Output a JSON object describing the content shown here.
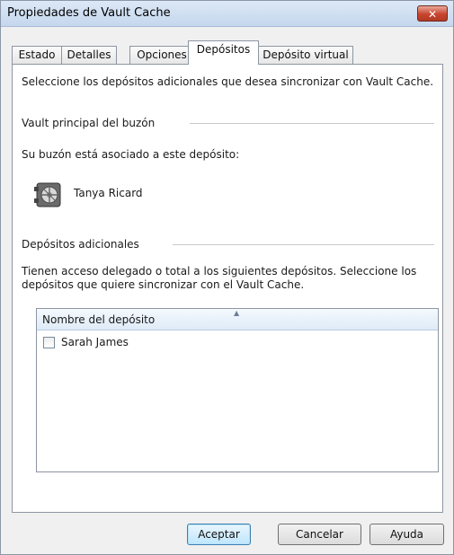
{
  "window": {
    "title": "Propiedades de Vault Cache",
    "close_glyph": "✕"
  },
  "tabs": [
    {
      "label": "Estado"
    },
    {
      "label": "Detalles"
    },
    {
      "label": "Opciones"
    },
    {
      "label": "Depósitos",
      "active": true
    },
    {
      "label": "Depósito virtual"
    }
  ],
  "panel": {
    "intro": "Seleccione los depósitos adicionales que desea sincronizar con Vault Cache.",
    "primary_group_title": "Vault principal del buzón",
    "primary_desc": "Su buzón está asociado a este depósito:",
    "primary_vault_name": "Tanya Ricard",
    "primary_vault_icon": "vault-icon",
    "additional_group_title": "Depósitos adicionales",
    "additional_desc_line1": "Tienen acceso delegado o total a los siguientes depósitos. Seleccione los",
    "additional_desc_line2": "depósitos que quiere sincronizar con el Vault Cache.",
    "list": {
      "column_header": "Nombre del depósito",
      "sort_glyph": "▲",
      "items": [
        {
          "label": "Sarah James",
          "checked": false
        }
      ]
    }
  },
  "buttons": {
    "ok": "Aceptar",
    "cancel": "Cancelar",
    "help": "Ayuda"
  }
}
